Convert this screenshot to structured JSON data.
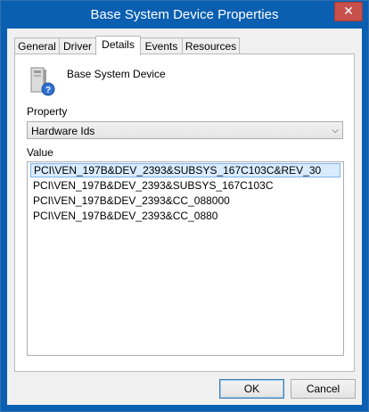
{
  "window": {
    "title": "Base System Device Properties",
    "close_label": "✕"
  },
  "tabs": [
    {
      "label": "General"
    },
    {
      "label": "Driver"
    },
    {
      "label": "Details",
      "active": true
    },
    {
      "label": "Events"
    },
    {
      "label": "Resources"
    }
  ],
  "details": {
    "device_name": "Base System Device",
    "device_icon": "unknown-device-icon",
    "property_label": "Property",
    "property_value": "Hardware Ids",
    "value_label": "Value",
    "values": [
      "PCI\\VEN_197B&DEV_2393&SUBSYS_167C103C&REV_30",
      "PCI\\VEN_197B&DEV_2393&SUBSYS_167C103C",
      "PCI\\VEN_197B&DEV_2393&CC_088000",
      "PCI\\VEN_197B&DEV_2393&CC_0880"
    ],
    "selected_index": 0
  },
  "buttons": {
    "ok_label": "OK",
    "cancel_label": "Cancel"
  },
  "colors": {
    "title_bar": "#0a5fb1",
    "close_button": "#c7504a",
    "selection": "#d9ecff"
  }
}
